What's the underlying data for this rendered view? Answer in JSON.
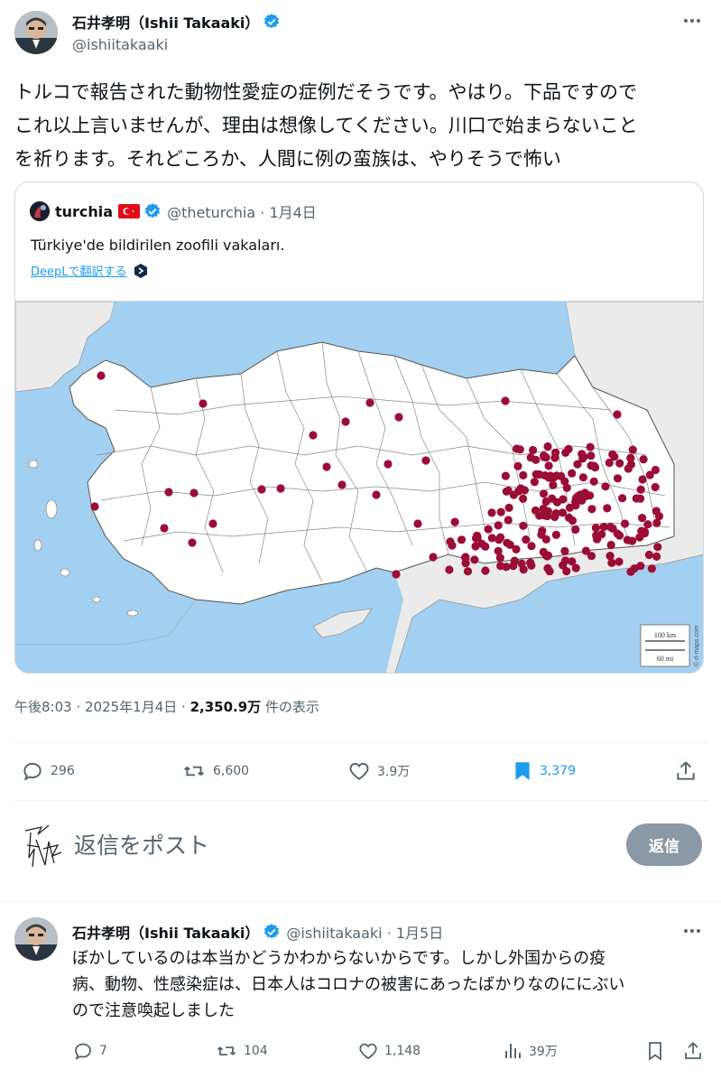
{
  "post": {
    "author_name": "石井孝明（Ishii Takaaki）",
    "handle": "@ishiitakaaki",
    "text": "トルコで報告された動物性愛症の症例だそうです。やはり。下品ですので\nこれ以上言いませんが、理由は想像してください。川口で始まらないこと\nを祈ります。それどころか、人間に例の蛮族は、やりそうで怖い",
    "timestamp": "午後8:03 · 2025年1月4日 · ",
    "views_count": "2,350.9万",
    "views_label": " 件の表示",
    "stats": {
      "replies": "296",
      "reposts": "6,600",
      "likes": "3.9万",
      "bookmarks": "3,379"
    }
  },
  "quote": {
    "author_name": "turchia",
    "handle": "@theturchia · 1月4日",
    "text": "Türkiye'de bildirilen zoofili vakaları.",
    "translate_label": "DeepLで翻訳する",
    "map": {
      "scale_km": "100 km",
      "scale_mi": "60 mi",
      "credit": "© d-maps.com"
    }
  },
  "reply_box": {
    "placeholder": "返信をポスト",
    "button_label": "返信"
  },
  "reply": {
    "author_name": "石井孝明（Ishii Takaaki）",
    "handle": "@ishiitakaaki · 1月5日",
    "text": "ぼかしているのは本当かどうかわからないからです。しかし外国からの疫\n病、動物、性感染症は、日本人はコロナの被害にあったばかりなのににぶい\nので注意喚起しました",
    "stats": {
      "replies": "7",
      "reposts": "104",
      "likes": "1,148",
      "views": "39万"
    }
  },
  "colors": {
    "accent": "#1d9bf0",
    "dot": "#9b0d35",
    "sea": "#a3cff0",
    "text_secondary": "#536471",
    "reply_button": "#8b98a5"
  },
  "icons": [
    "verified-badge-icon",
    "more-icon",
    "turkey-flag-icon",
    "deepl-icon",
    "reply-icon",
    "repost-icon",
    "like-icon",
    "bookmark-icon",
    "share-icon",
    "views-icon"
  ]
}
